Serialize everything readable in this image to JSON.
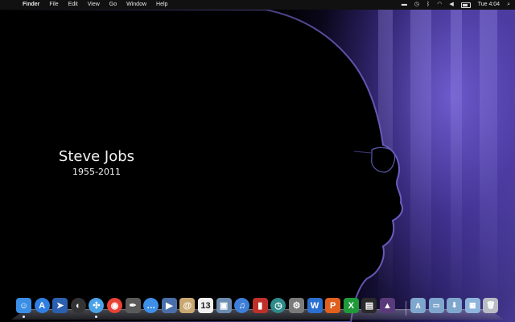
{
  "menubar": {
    "apple_icon": "apple-icon",
    "app_name": "Finder",
    "menus": [
      "File",
      "Edit",
      "View",
      "Go",
      "Window",
      "Help"
    ],
    "status_icons": [
      "hard-drive-icon",
      "time-machine-icon",
      "bluetooth-icon",
      "wifi-icon",
      "volume-icon",
      "battery-icon"
    ],
    "clock": "Tue 4:04",
    "spotlight_icon": "spotlight-icon"
  },
  "wallpaper": {
    "name": "Steve Jobs",
    "years": "1955-2011"
  },
  "dock": {
    "apps": [
      {
        "name": "finder",
        "color": "#3a8ee6",
        "glyph": "☺",
        "running": true
      },
      {
        "name": "app-store",
        "color": "#2f7fe0",
        "glyph": "A",
        "running": false
      },
      {
        "name": "mail-plane",
        "color": "#2b5fb0",
        "glyph": "➤",
        "running": false
      },
      {
        "name": "dashboard",
        "color": "#333333",
        "glyph": "◐",
        "running": false
      },
      {
        "name": "safari",
        "color": "#4aa3e8",
        "glyph": "✣",
        "running": true
      },
      {
        "name": "chrome",
        "color": "#e94235",
        "glyph": "◉",
        "running": false
      },
      {
        "name": "quill",
        "color": "#5a5a5a",
        "glyph": "✒",
        "running": false
      },
      {
        "name": "messages",
        "color": "#3d8fe8",
        "glyph": "…",
        "running": false
      },
      {
        "name": "facetime",
        "color": "#4a6fa8",
        "glyph": "▶",
        "running": false
      },
      {
        "name": "contacts",
        "color": "#c8a870",
        "glyph": "@",
        "running": false
      },
      {
        "name": "calendar",
        "color": "#f0f0f0",
        "glyph": "13",
        "running": false
      },
      {
        "name": "preview",
        "color": "#6c8cb0",
        "glyph": "▣",
        "running": false
      },
      {
        "name": "itunes",
        "color": "#3d7fd8",
        "glyph": "♫",
        "running": false
      },
      {
        "name": "photo-booth",
        "color": "#c0302a",
        "glyph": "▮",
        "running": false
      },
      {
        "name": "time-machine",
        "color": "#2f8a8a",
        "glyph": "◷",
        "running": false
      },
      {
        "name": "system-preferences",
        "color": "#7a7a7a",
        "glyph": "⚙",
        "running": false
      },
      {
        "name": "word",
        "color": "#2b6fd0",
        "glyph": "W",
        "running": false
      },
      {
        "name": "powerpoint",
        "color": "#e0601e",
        "glyph": "P",
        "running": false
      },
      {
        "name": "excel",
        "color": "#1f9a3a",
        "glyph": "X",
        "running": false
      },
      {
        "name": "activity-monitor",
        "color": "#2a2a2a",
        "glyph": "▤",
        "running": false
      },
      {
        "name": "wizard-hat",
        "color": "#5a3a7a",
        "glyph": "▲",
        "running": false
      }
    ],
    "folders": [
      {
        "name": "applications-folder",
        "color": "#7fa6cc",
        "glyph": "A"
      },
      {
        "name": "documents-folder",
        "color": "#7fa6cc",
        "glyph": "▭"
      },
      {
        "name": "downloads-folder",
        "color": "#7fa6cc",
        "glyph": "⬇"
      },
      {
        "name": "desktop-stack",
        "color": "#8fb4dc",
        "glyph": "▦"
      },
      {
        "name": "trash",
        "color": "#b8bcc4",
        "glyph": "🗑"
      }
    ]
  }
}
